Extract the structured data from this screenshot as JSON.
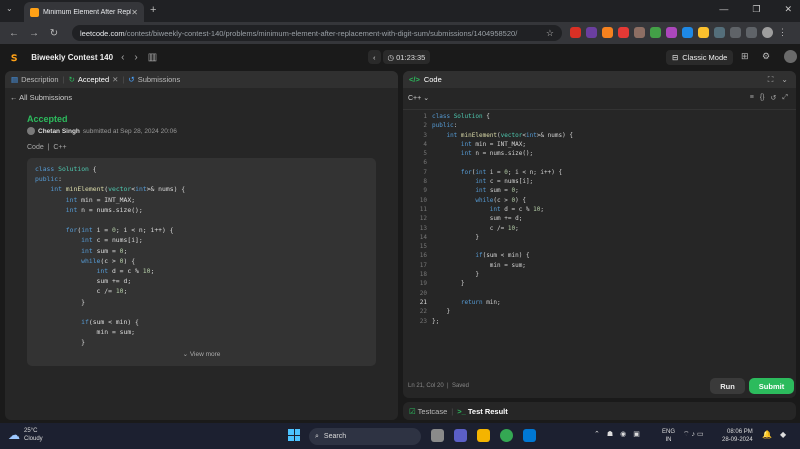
{
  "browser": {
    "tab_title": "Minimum Element After Replac",
    "url_domain": "leetcode.com",
    "url_path": "/contest/biweekly-contest-140/problems/minimum-element-after-replacement-with-digit-sum/submissions/1404958520/"
  },
  "header": {
    "contest": "Biweekly Contest 140",
    "timer": "01:23:35",
    "classic_mode": "Classic Mode"
  },
  "left_panel": {
    "tabs": [
      "Description",
      "Accepted",
      "Submissions"
    ],
    "back_link": "All Submissions",
    "status": "Accepted",
    "author": "Chetan Singh",
    "submitted_text": "submitted at Sep 28, 2024 20:06",
    "code_label": "Code",
    "lang_label": "C++",
    "view_more": "View more"
  },
  "right_panel": {
    "title": "Code",
    "language": "C++",
    "cursor_status": "Ln 21, Col 20",
    "save_status": "Saved",
    "run_label": "Run",
    "submit_label": "Submit",
    "bottom_tabs": [
      "Testcase",
      "Test Result"
    ]
  },
  "code_lines": [
    "class Solution {",
    "public:",
    "    int minElement(vector<int>& nums) {",
    "        int min = INT_MAX;",
    "        int n = nums.size();",
    "",
    "        for(int i = 0; i < n; i++) {",
    "            int c = nums[i];",
    "            int sum = 0;",
    "            while(c > 0) {",
    "                int d = c % 10;",
    "                sum += d;",
    "                c /= 10;",
    "            }",
    "",
    "            if(sum < min) {",
    "                min = sum;",
    "            }",
    "        }",
    "",
    "        return min;",
    "    }",
    "};"
  ],
  "taskbar": {
    "temperature": "25°C",
    "condition": "Cloudy",
    "search": "Search",
    "lang_top": "ENG",
    "lang_bottom": "IN",
    "time": "08:06 PM",
    "date": "28-09-2024"
  },
  "colors": {
    "accent": "#ffa116",
    "accepted": "#2cbb5d"
  }
}
